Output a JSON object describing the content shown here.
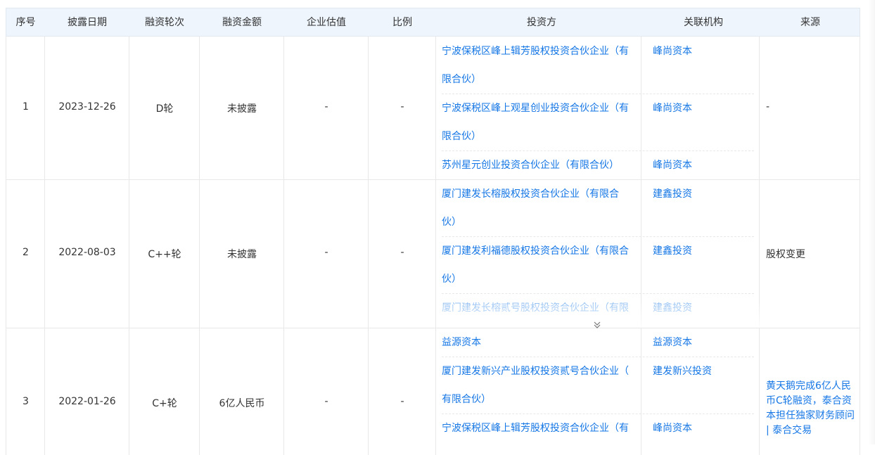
{
  "headers": [
    "序号",
    "披露日期",
    "融资轮次",
    "融资金额",
    "企业估值",
    "比例",
    "投资方",
    "关联机构",
    "来源"
  ],
  "rows": [
    {
      "index": "1",
      "date": "2023-12-26",
      "round": "D轮",
      "amount": "未披露",
      "valuation": "-",
      "ratio": "-",
      "investors": [
        {
          "name_line1": "宁波保税区峰上辑芳股权投资合伙企业（有",
          "name_line2": "限合伙）",
          "org": "峰尚资本"
        },
        {
          "name_line1": "宁波保税区峰上观星创业投资合伙企业（有",
          "name_line2": "限合伙）",
          "org": "峰尚资本"
        },
        {
          "name_line1": "苏州星元创业投资合伙企业（有限合伙）",
          "name_line2": "",
          "org": "峰尚资本"
        }
      ],
      "source": "-"
    },
    {
      "index": "2",
      "date": "2022-08-03",
      "round": "C++轮",
      "amount": "未披露",
      "valuation": "-",
      "ratio": "-",
      "investors": [
        {
          "name_line1": "厦门建发长榕股权投资合伙企业（有限合",
          "name_line2": "伙）",
          "org": "建鑫投资"
        },
        {
          "name_line1": "厦门建发利福德股权投资合伙企业（有限合",
          "name_line2": "伙）",
          "org": "建鑫投资"
        },
        {
          "name_line1": "厦门建发长榕贰号股权投资合伙企业（有限",
          "name_line2": "",
          "org": "建鑫投资"
        }
      ],
      "source": "股权变更"
    },
    {
      "index": "3",
      "date": "2022-01-26",
      "round": "C+轮",
      "amount": "6亿人民币",
      "valuation": "-",
      "ratio": "-",
      "investors": [
        {
          "name_line1": "益源资本",
          "name_line2": "",
          "org": "益源资本"
        },
        {
          "name_line1": "厦门建发新兴产业股权投资贰号合伙企业（",
          "name_line2": "有限合伙）",
          "org": "建发新兴投资"
        },
        {
          "name_line1": "宁波保税区峰上辑芳股权投资合伙企业（有",
          "name_line2": "",
          "org": "峰尚资本"
        }
      ],
      "source_link": [
        "黄天鹅完成6亿人民",
        "币C轮融资，泰合资",
        "本担任独家财务顾问",
        "| 泰合交易"
      ]
    }
  ],
  "colors": {
    "header_bg": "#eef5fd",
    "link": "#1677e5",
    "border": "#e8e8e8"
  }
}
